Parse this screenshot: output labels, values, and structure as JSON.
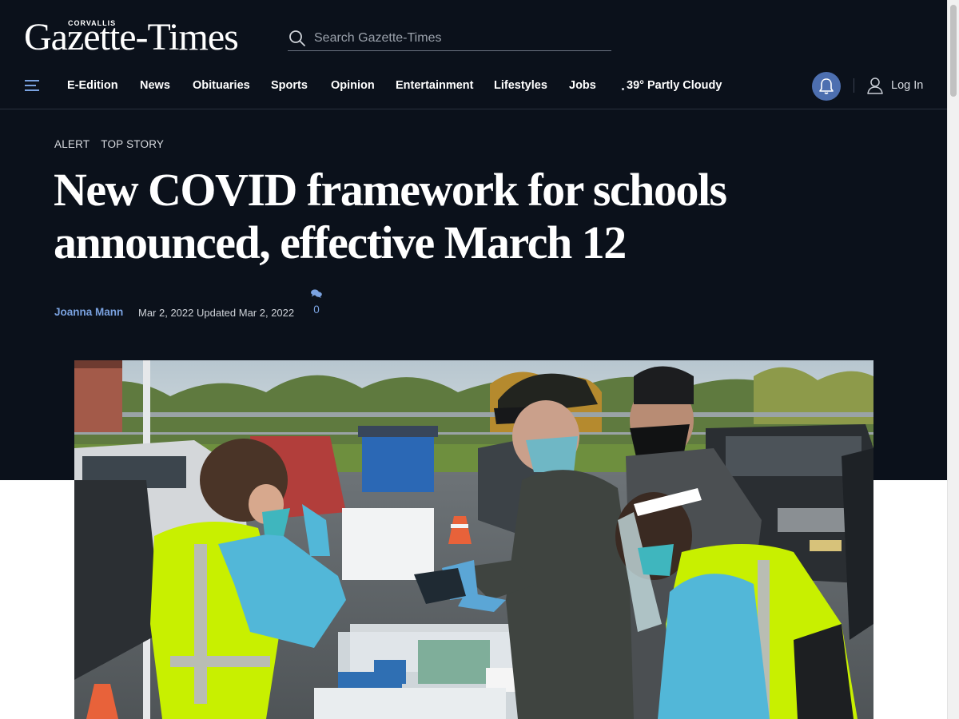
{
  "header": {
    "logo_small": "CORVALLIS",
    "logo_main": "Gazette-Times",
    "search_placeholder": "Search Gazette-Times"
  },
  "nav": {
    "items": [
      "E-Edition",
      "News",
      "Obituaries",
      "Sports",
      "Opinion",
      "Entertainment",
      "Lifestyles",
      "Jobs"
    ],
    "weather": "39° Partly Cloudy",
    "login": "Log In"
  },
  "article": {
    "flags": [
      "ALERT",
      "TOP STORY"
    ],
    "headline": "New COVID framework for schools announced, effective March 12",
    "author": "Joanna Mann",
    "dateline": "Mar 2, 2022 Updated Mar 2, 2022",
    "comment_count": "0"
  },
  "colors": {
    "header_bg": "#0b111b",
    "accent_blue": "#4d6fb0",
    "link_blue": "#7aa2e0",
    "vest_yellow": "#c8f000"
  }
}
